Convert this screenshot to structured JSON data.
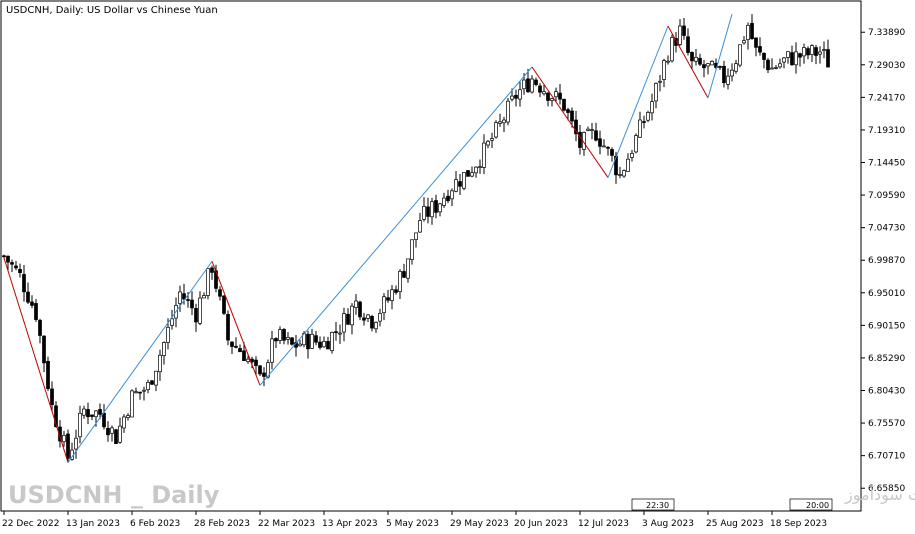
{
  "header": {
    "title": "USDCNH, Daily:  US Dollar vs Chinese Yuan"
  },
  "watermark": {
    "symbol_period": "USDCNH _ Daily",
    "site_text": "انتشار در سایت سودآموز"
  },
  "time_badges": [
    "22:30",
    "20:00"
  ],
  "colors": {
    "zigzag_up": "#3a8fd8",
    "zigzag_down": "#c00000",
    "candle": "#000000",
    "frame": "#000000",
    "watermark": "#c8c8c8"
  },
  "chart_data": {
    "type": "candlestick",
    "title": "USDCNH, Daily:  US Dollar vs Chinese Yuan",
    "ylim": [
      6.626,
      7.384
    ],
    "y_ticks": [
      "7.33890",
      "7.29030",
      "7.24170",
      "7.19310",
      "7.14450",
      "7.09590",
      "7.04730",
      "6.99870",
      "6.95010",
      "6.90150",
      "6.85290",
      "6.80430",
      "6.75570",
      "6.70710",
      "6.65850"
    ],
    "x_ticks": [
      "22 Dec 2022",
      "13 Jan 2023",
      "6 Feb 2023",
      "28 Feb 2023",
      "22 Mar 2023",
      "13 Apr 2023",
      "5 May 2023",
      "29 May 2023",
      "20 Jun 2023",
      "12 Jul 2023",
      "3 Aug 2023",
      "25 Aug 2023",
      "18 Sep 2023"
    ],
    "x_tick_bar_index": [
      0,
      16,
      32,
      48,
      64,
      80,
      96,
      112,
      128,
      144,
      160,
      176,
      192
    ],
    "bar_count": 207,
    "anchors": [
      {
        "i": 0,
        "c": 7.005
      },
      {
        "i": 4,
        "c": 6.975
      },
      {
        "i": 8,
        "c": 6.92
      },
      {
        "i": 12,
        "c": 6.78
      },
      {
        "i": 16,
        "c": 6.705
      },
      {
        "i": 20,
        "c": 6.775
      },
      {
        "i": 24,
        "c": 6.77
      },
      {
        "i": 28,
        "c": 6.735
      },
      {
        "i": 32,
        "c": 6.795
      },
      {
        "i": 36,
        "c": 6.81
      },
      {
        "i": 40,
        "c": 6.875
      },
      {
        "i": 44,
        "c": 6.95
      },
      {
        "i": 48,
        "c": 6.92
      },
      {
        "i": 52,
        "c": 6.99
      },
      {
        "i": 56,
        "c": 6.88
      },
      {
        "i": 60,
        "c": 6.86
      },
      {
        "i": 64,
        "c": 6.82
      },
      {
        "i": 68,
        "c": 6.885
      },
      {
        "i": 72,
        "c": 6.87
      },
      {
        "i": 76,
        "c": 6.88
      },
      {
        "i": 80,
        "c": 6.875
      },
      {
        "i": 84,
        "c": 6.9
      },
      {
        "i": 88,
        "c": 6.935
      },
      {
        "i": 92,
        "c": 6.91
      },
      {
        "i": 96,
        "c": 6.94
      },
      {
        "i": 100,
        "c": 6.985
      },
      {
        "i": 104,
        "c": 7.06
      },
      {
        "i": 108,
        "c": 7.08
      },
      {
        "i": 112,
        "c": 7.11
      },
      {
        "i": 116,
        "c": 7.13
      },
      {
        "i": 120,
        "c": 7.16
      },
      {
        "i": 124,
        "c": 7.2
      },
      {
        "i": 128,
        "c": 7.245
      },
      {
        "i": 132,
        "c": 7.27
      },
      {
        "i": 136,
        "c": 7.25
      },
      {
        "i": 140,
        "c": 7.23
      },
      {
        "i": 144,
        "c": 7.17
      },
      {
        "i": 148,
        "c": 7.19
      },
      {
        "i": 152,
        "c": 7.15
      },
      {
        "i": 154,
        "c": 7.125
      },
      {
        "i": 158,
        "c": 7.18
      },
      {
        "i": 162,
        "c": 7.235
      },
      {
        "i": 166,
        "c": 7.31
      },
      {
        "i": 169,
        "c": 7.34
      },
      {
        "i": 172,
        "c": 7.29
      },
      {
        "i": 176,
        "c": 7.285
      },
      {
        "i": 180,
        "c": 7.27
      },
      {
        "i": 183,
        "c": 7.3
      },
      {
        "i": 186,
        "c": 7.35
      },
      {
        "i": 188,
        "c": 7.31
      },
      {
        "i": 192,
        "c": 7.285
      },
      {
        "i": 196,
        "c": 7.3
      },
      {
        "i": 200,
        "c": 7.305
      },
      {
        "i": 204,
        "c": 7.31
      },
      {
        "i": 206,
        "c": 7.295
      }
    ],
    "zigzag": [
      {
        "i": 0,
        "v": 7.002,
        "dir": "down"
      },
      {
        "i": 16,
        "v": 6.697,
        "dir": "up"
      },
      {
        "i": 52,
        "v": 6.997,
        "dir": "down"
      },
      {
        "i": 64,
        "v": 6.812,
        "dir": "up"
      },
      {
        "i": 132,
        "v": 7.287,
        "dir": "down"
      },
      {
        "i": 151,
        "v": 7.122,
        "dir": "up"
      },
      {
        "i": 166,
        "v": 7.348,
        "dir": "down"
      },
      {
        "i": 176,
        "v": 7.241,
        "dir": "up"
      },
      {
        "i": 182,
        "v": 7.366,
        "dir": "none"
      }
    ]
  }
}
